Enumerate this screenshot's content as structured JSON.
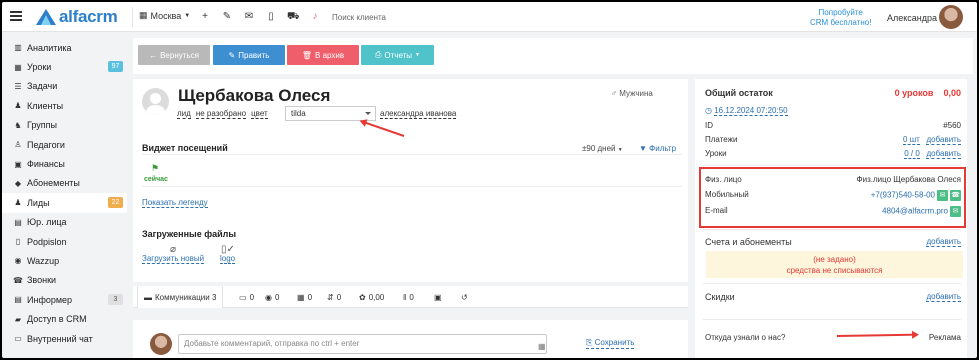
{
  "topbar": {
    "logo_text": "alfacrm",
    "city": "Москва",
    "search_placeholder": "Поиск клиента",
    "promo_line1": "Попробуйте",
    "promo_line2": "CRM бесплатно!",
    "user_name": "Александра"
  },
  "sidebar": {
    "items": [
      {
        "label": "Аналитика",
        "icon": "chart-icon"
      },
      {
        "label": "Уроки",
        "icon": "calendar-icon",
        "badge": "97",
        "badge_color": "#5bc0de"
      },
      {
        "label": "Задачи",
        "icon": "tasks-icon"
      },
      {
        "label": "Клиенты",
        "icon": "user-icon"
      },
      {
        "label": "Группы",
        "icon": "users-icon"
      },
      {
        "label": "Педагоги",
        "icon": "teacher-icon"
      },
      {
        "label": "Финансы",
        "icon": "money-icon"
      },
      {
        "label": "Абонементы",
        "icon": "tag-icon"
      },
      {
        "label": "Лиды",
        "icon": "lead-icon",
        "badge": "22",
        "badge_color": "#f0ad4e",
        "active": true
      },
      {
        "label": "Юр. лица",
        "icon": "building-icon"
      },
      {
        "label": "Podpislon",
        "icon": "doc-icon"
      },
      {
        "label": "Wazzup",
        "icon": "chat-icon"
      },
      {
        "label": "Звонки",
        "icon": "phone-icon"
      },
      {
        "label": "Информер",
        "icon": "informer-icon",
        "badge": "3",
        "badge_color": "#e0e0e0"
      },
      {
        "label": "Доступ в CRM",
        "icon": "lock-icon"
      },
      {
        "label": "Внутренний чат",
        "icon": "message-icon"
      }
    ]
  },
  "actions": {
    "back": "Вернуться",
    "edit": "Править",
    "archive": "В архив",
    "reports": "Отчеты"
  },
  "client": {
    "name": "Щербакова Олеся",
    "gender": "Мужчина",
    "tag_lead": "лид",
    "tag_status": "не разобрано",
    "tag_color": "цвет",
    "source_select": "tilda",
    "owner": "александра иванова"
  },
  "visits": {
    "title": "Виджет посещений",
    "period": "±90 дней",
    "filter": "Фильтр",
    "now": "сейчас",
    "legend": "Показать легенду"
  },
  "files": {
    "title": "Загруженные файлы",
    "upload": "Загрузить новый",
    "logo": "logo"
  },
  "tabs": [
    {
      "label": "Коммуникации 3",
      "icon": "comments-icon"
    },
    {
      "label": "0",
      "icon": "message-icon"
    },
    {
      "label": "0",
      "icon": "whatsapp-icon"
    },
    {
      "label": "0",
      "icon": "calendar-icon"
    },
    {
      "label": "0",
      "icon": "move-icon"
    },
    {
      "label": "0,00",
      "icon": "gift-icon"
    },
    {
      "label": "0",
      "icon": "pause-icon"
    },
    {
      "label": "",
      "icon": "money-icon"
    },
    {
      "label": "",
      "icon": "history-icon"
    }
  ],
  "comment": {
    "placeholder": "Добавьте комментарий, отправка по ctrl + enter",
    "save": "Сохранить"
  },
  "balance": {
    "title": "Общий остаток",
    "lessons": "0 уроков",
    "amount": "0,00",
    "datetime": "16.12.2024 07:20:50",
    "id_label": "ID",
    "id_value": "#560",
    "payments_label": "Платежи",
    "payments_value": "0 шт",
    "payments_add": "добавить",
    "lessons_label": "Уроки",
    "lessons_value": "0 / 0",
    "lessons_add": "добавить"
  },
  "contact": {
    "person_label": "Физ. лицо",
    "person_value": "Физ.лицо Щербакова Олеся",
    "mobile_label": "Мобильный",
    "mobile_value": "+7(937)540-58-00",
    "email_label": "E-mail",
    "email_value": "4804@alfacrm.pro"
  },
  "subscriptions": {
    "title": "Счета и абонементы",
    "add": "добавить",
    "warn_line1": "(не задано)",
    "warn_line2": "средства не списываются"
  },
  "discounts": {
    "title": "Скидки",
    "add": "добавить"
  },
  "source": {
    "label": "Откуда узнали о нас?",
    "value": "Реклама"
  }
}
